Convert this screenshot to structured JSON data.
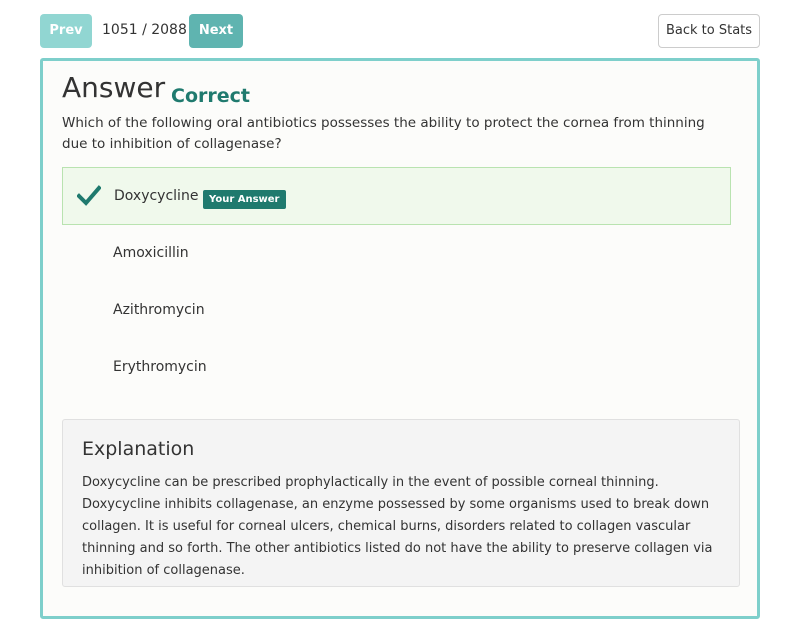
{
  "nav": {
    "prev_label": "Prev",
    "counter": "1051 / 2088",
    "next_label": "Next",
    "back_label": "Back to Stats"
  },
  "answer": {
    "title": "Answer",
    "verdict": "Correct",
    "question": "Which of the following oral antibiotics possesses the ability to protect the cornea from thinning due to inhibition of collagenase?",
    "options": [
      {
        "label": "Doxycycline",
        "badge": "Your Answer",
        "selected": true,
        "icon": "checkmark-icon"
      },
      {
        "label": "Amoxicillin"
      },
      {
        "label": "Azithromycin"
      },
      {
        "label": "Erythromycin"
      }
    ]
  },
  "explanation": {
    "title": "Explanation",
    "text": "Doxycycline can be prescribed prophylactically in the event of possible corneal thinning. Doxycycline inhibits collagenase, an enzyme possessed by some organisms used to break down collagen. It is useful for corneal ulcers, chemical burns, disorders related to collagen vascular thinning and so forth. The other antibiotics listed do not have the ability to preserve collagen via inhibition of collagenase."
  },
  "colors": {
    "accent": "#7ecfcb",
    "correct": "#1f7a6e",
    "selected_bg": "#f0f9ec"
  }
}
